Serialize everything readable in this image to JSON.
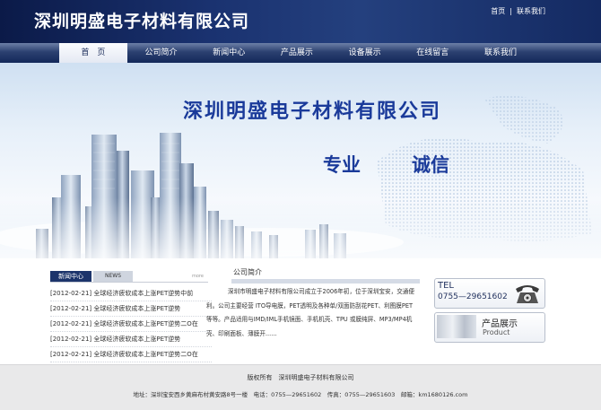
{
  "header": {
    "site_title": "深圳明盛电子材料有限公司",
    "links": [
      "首页",
      "联系我们"
    ]
  },
  "nav": {
    "items": [
      "首　页",
      "公司简介",
      "新闻中心",
      "产品展示",
      "设备展示",
      "在线留言",
      "联系我们"
    ],
    "active_index": 0
  },
  "banner": {
    "title": "深圳明盛电子材料有限公司",
    "slogans": [
      "专业",
      "诚信"
    ]
  },
  "news": {
    "tabs": [
      "新闻中心",
      "NEWS"
    ],
    "more": "more",
    "items": [
      {
        "date": "[2012-02-21]",
        "title": "全球经济疲软成本上涨PET逆势中前"
      },
      {
        "date": "[2012-02-21]",
        "title": "全球经济疲软成本上涨PET逆势"
      },
      {
        "date": "[2012-02-21]",
        "title": "全球经济疲软成本上涨PET逆势二O在"
      },
      {
        "date": "[2012-02-21]",
        "title": "全球经济疲软成本上涨PET逆势"
      },
      {
        "date": "[2012-02-21]",
        "title": "全球经济疲软成本上涨PET逆势二O在"
      }
    ]
  },
  "about": {
    "title": "公司简介",
    "text": "深圳市明盛电子材料有限公司成立于2006年初，位于深圳宝安，交通便利。公司主要经营 ITO导电膜，PET透明及各种单/双面防刮花PET、利图膜PET等等。产品适用与IMD/IML手机镜面、手机机壳、TPU 或膜纯屏、MP3/MP4机壳、印刷面板、薄膜开......"
  },
  "contact": {
    "tel_label": "TEL",
    "tel_number": "0755—29651602"
  },
  "product": {
    "title_cn": "产品展示",
    "title_en": "Product"
  },
  "footer": {
    "copyright": "版权所有　深圳明盛电子材料有限公司",
    "address": "地址：深圳宝安西乡黄麻布村黄安路8号一楼　电话：0755—29651602　传真：0755—29651603　邮箱：km1680126.com"
  },
  "colors": {
    "header_dark": "#0b1a48",
    "banner_text": "#1a3a9a",
    "footer_bg": "#e9e9ea"
  }
}
